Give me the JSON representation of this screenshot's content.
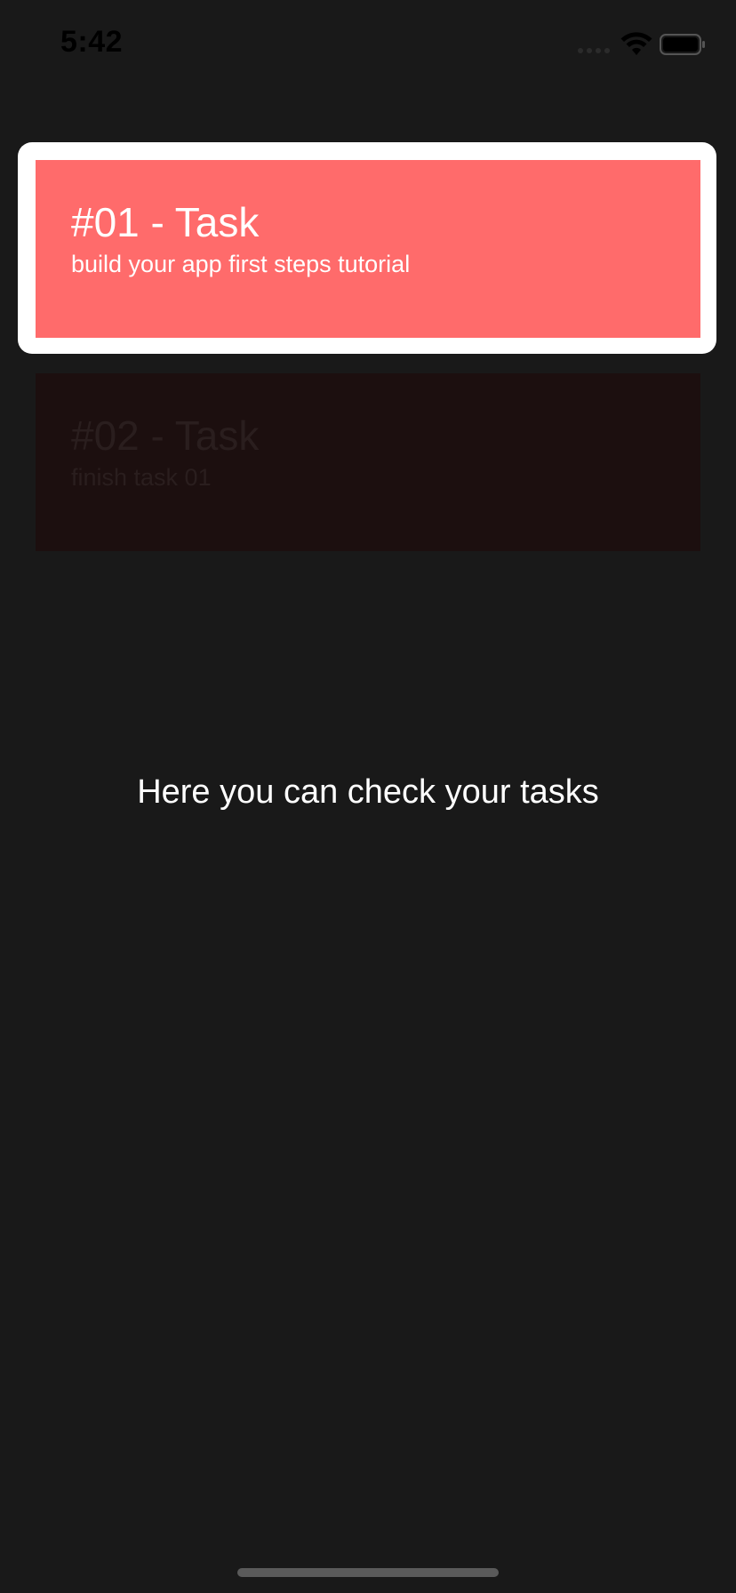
{
  "status_bar": {
    "time": "5:42",
    "icons": [
      "cellular-signal-icon",
      "wifi-icon",
      "battery-icon"
    ]
  },
  "tasks": [
    {
      "title": "#01 - Task",
      "subtitle": "build your app first steps tutorial",
      "highlighted": true,
      "color": "#ff6b6b"
    },
    {
      "title": "#02 - Task",
      "subtitle": "finish task 01",
      "highlighted": false,
      "color": "#1c0f0f"
    }
  ],
  "hint": "Here you can check your tasks",
  "colors": {
    "background": "#191919",
    "highlight_frame": "#ffffff",
    "active_task": "#ff6b6b"
  }
}
